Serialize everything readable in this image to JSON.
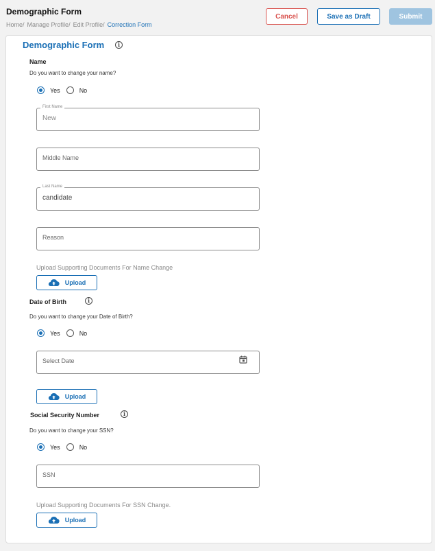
{
  "header": {
    "title": "Demographic Form",
    "breadcrumb": [
      {
        "label": "Home",
        "sep": "/"
      },
      {
        "label": "Manage Profile",
        "sep": "/"
      },
      {
        "label": "Edit Profile",
        "sep": "/"
      },
      {
        "label": "Correction Form",
        "sep": ""
      }
    ],
    "buttons": {
      "cancel": "Cancel",
      "save_draft": "Save as Draft",
      "submit": "Submit"
    }
  },
  "colors": {
    "accent": "#1a6fb5",
    "danger": "#d9534f",
    "submit_disabled": "#9fc4e0"
  },
  "form": {
    "title": "Demographic Form",
    "info_icon": "info-icon",
    "name_section": {
      "label": "Name",
      "question": "Do you want to change your name?",
      "options": {
        "yes": "Yes",
        "no": "No",
        "selected": "Yes"
      },
      "first_name": {
        "label": "First Name",
        "value": "New"
      },
      "middle_name": {
        "placeholder": "Middle Name"
      },
      "last_name": {
        "label": "Last Name",
        "value": "candidate"
      },
      "reason": {
        "placeholder": "Reason"
      },
      "upload_hint": "Upload Supporting Documents For Name Change",
      "upload_label": "Upload"
    },
    "dob_section": {
      "label": "Date of Birth",
      "question": "Do you want to change your Date of Birth?",
      "options": {
        "yes": "Yes",
        "no": "No",
        "selected": "Yes"
      },
      "date": {
        "placeholder": "Select Date",
        "icon": "calendar-icon"
      },
      "upload_label": "Upload"
    },
    "ssn_section": {
      "label": "Social Security Number",
      "question": "Do you want to change your SSN?",
      "options": {
        "yes": "Yes",
        "no": "No",
        "selected": "Yes"
      },
      "ssn": {
        "placeholder": "SSN"
      },
      "upload_hint": "Upload Supporting Documents For SSN Change.",
      "upload_label": "Upload"
    }
  }
}
